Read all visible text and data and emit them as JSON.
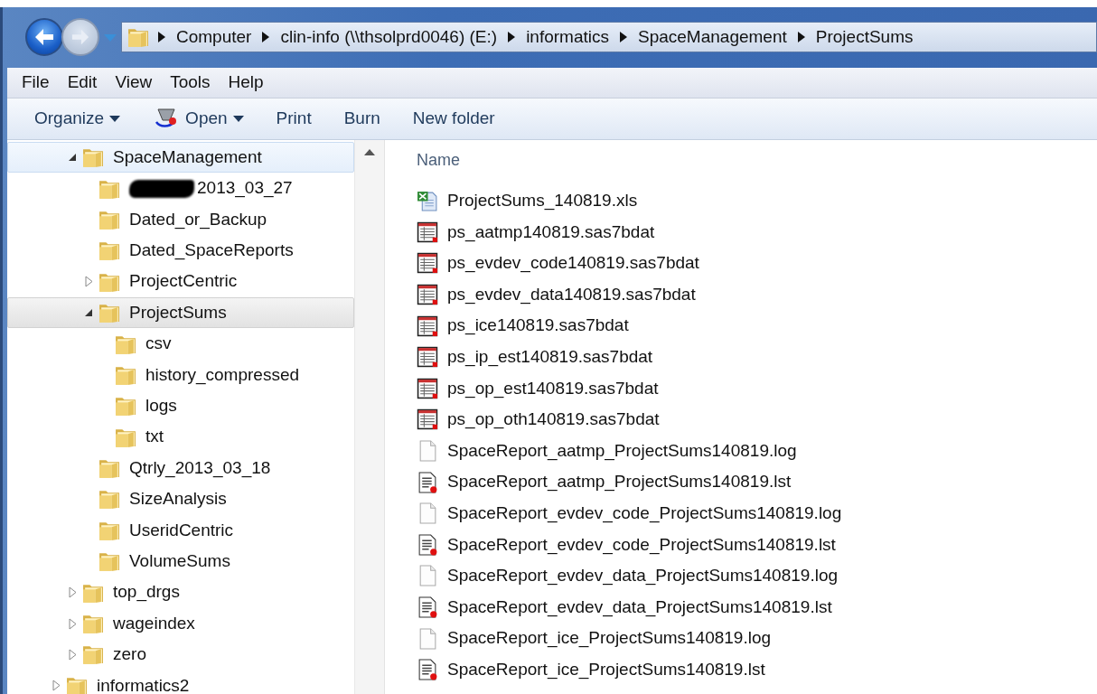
{
  "address_bar": {
    "crumbs": [
      "Computer",
      "clin-info (\\\\thsolprd0046) (E:)",
      "informatics",
      "SpaceManagement",
      "ProjectSums"
    ]
  },
  "menu_bar": [
    "File",
    "Edit",
    "View",
    "Tools",
    "Help"
  ],
  "toolbar": [
    {
      "label": "Organize",
      "kind": "dropdown"
    },
    {
      "label": "Open",
      "kind": "open"
    },
    {
      "label": "Print",
      "kind": "plain"
    },
    {
      "label": "Burn",
      "kind": "plain"
    },
    {
      "label": "New folder",
      "kind": "plain"
    }
  ],
  "tree": [
    {
      "children": [
        {
          "label": "SpaceManagement",
          "expanded": true,
          "selected": false,
          "hovered": true,
          "children": [
            {
              "label": "2013_03_27",
              "redacted": true,
              "selected": false,
              "hovered": false
            },
            {
              "label": "Dated_or_Backup",
              "selected": false,
              "hovered": false
            },
            {
              "label": "Dated_SpaceReports",
              "selected": false,
              "hovered": false
            },
            {
              "label": "ProjectCentric",
              "expanded": false,
              "selected": false,
              "hovered": false
            },
            {
              "label": "ProjectSums",
              "expanded": true,
              "selected": true,
              "hovered": false,
              "children": [
                {
                  "label": "csv",
                  "selected": false,
                  "hovered": false
                },
                {
                  "label": "history_compressed",
                  "selected": false,
                  "hovered": false
                },
                {
                  "label": "logs",
                  "selected": false,
                  "hovered": false
                },
                {
                  "label": "txt",
                  "selected": false,
                  "hovered": false
                }
              ]
            },
            {
              "label": "Qtrly_2013_03_18",
              "selected": false,
              "hovered": false
            },
            {
              "label": "SizeAnalysis",
              "selected": false,
              "hovered": false
            },
            {
              "label": "UseridCentric",
              "selected": false,
              "hovered": false
            },
            {
              "label": "VolumeSums",
              "selected": false,
              "hovered": false
            }
          ]
        },
        {
          "label": "top_drgs",
          "expanded": false,
          "selected": false,
          "hovered": false
        },
        {
          "label": "wageindex",
          "expanded": false,
          "selected": false,
          "hovered": false
        },
        {
          "label": "zero",
          "expanded": false,
          "selected": false,
          "hovered": false
        }
      ]
    },
    {
      "label": "informatics2",
      "expanded": false,
      "selected": false,
      "hovered": false
    }
  ],
  "file_list": {
    "columns": [
      "Name"
    ],
    "files": [
      {
        "name": "ProjectSums_140819.xls",
        "kind": "excel"
      },
      {
        "name": "ps_aatmp140819.sas7bdat",
        "kind": "sas"
      },
      {
        "name": "ps_evdev_code140819.sas7bdat",
        "kind": "sas"
      },
      {
        "name": "ps_evdev_data140819.sas7bdat",
        "kind": "sas"
      },
      {
        "name": "ps_ice140819.sas7bdat",
        "kind": "sas"
      },
      {
        "name": "ps_ip_est140819.sas7bdat",
        "kind": "sas"
      },
      {
        "name": "ps_op_est140819.sas7bdat",
        "kind": "sas"
      },
      {
        "name": "ps_op_oth140819.sas7bdat",
        "kind": "sas"
      },
      {
        "name": "SpaceReport_aatmp_ProjectSums140819.log",
        "kind": "text"
      },
      {
        "name": "SpaceReport_aatmp_ProjectSums140819.lst",
        "kind": "listing"
      },
      {
        "name": "SpaceReport_evdev_code_ProjectSums140819.log",
        "kind": "text"
      },
      {
        "name": "SpaceReport_evdev_code_ProjectSums140819.lst",
        "kind": "listing"
      },
      {
        "name": "SpaceReport_evdev_data_ProjectSums140819.log",
        "kind": "text"
      },
      {
        "name": "SpaceReport_evdev_data_ProjectSums140819.lst",
        "kind": "listing"
      },
      {
        "name": "SpaceReport_ice_ProjectSums140819.log",
        "kind": "text"
      },
      {
        "name": "SpaceReport_ice_ProjectSums140819.lst",
        "kind": "listing"
      }
    ]
  }
}
